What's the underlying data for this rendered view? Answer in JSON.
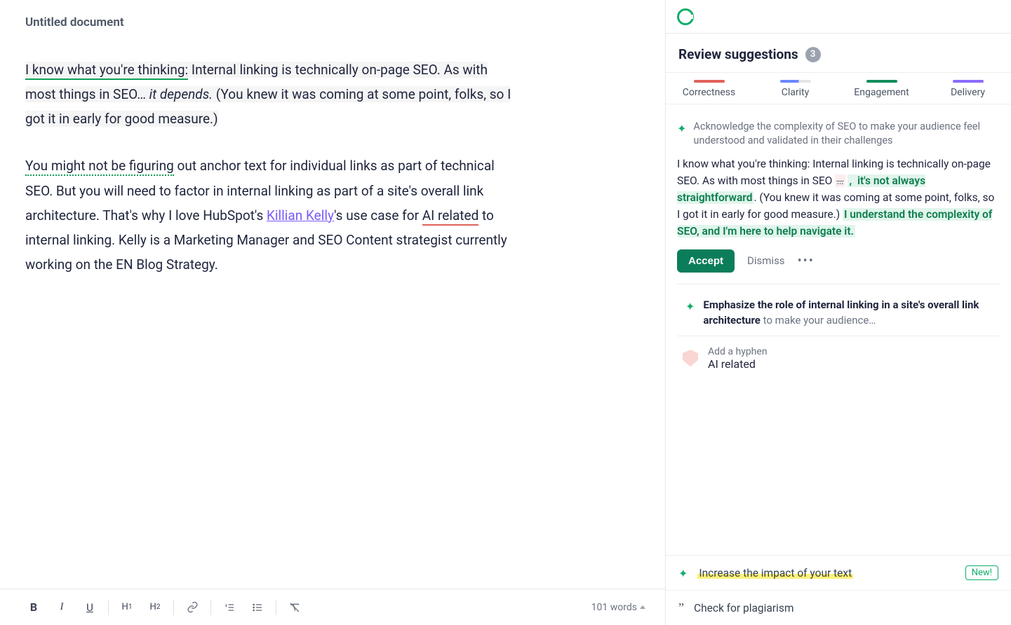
{
  "doc": {
    "title": "Untitled document",
    "p1a": "I know what you're thinking:",
    "p1b": " Internal linking is technically on-page SEO. As with most things in SEO… ",
    "p1c": "it depends.",
    "p1d": " (You knew it was coming at some point, folks, so I got it in early for good measure.)",
    "p2a": "You might not be figuring",
    "p2b": " out anchor text for individual links as part of technical SEO. But you will need to factor in internal linking as part of a site's overall link architecture. That's why I love HubSpot's ",
    "p2c": "Killian Kelly",
    "p2d": "'s use case for ",
    "p2e": "AI related",
    "p2f": " to internal linking. Kelly is a Marketing Manager and SEO Content strategist currently working on the EN Blog Strategy."
  },
  "toolbar": {
    "bold": "B",
    "italic": "I",
    "underline": "U",
    "h1": "H1",
    "h2": "H2",
    "word_count": "101 words"
  },
  "sidebar": {
    "title": "Review suggestions",
    "count": "3",
    "tabs": {
      "correctness": "Correctness",
      "clarity": "Clarity",
      "engagement": "Engagement",
      "delivery": "Delivery"
    },
    "card1": {
      "desc": "Acknowledge the complexity of SEO to make your audience feel understood and validated in their challenges",
      "t1": "I know what you're thinking: Internal linking is technically on-page SEO. As with most things in SEO ",
      "strike": "…",
      "ins1": ", ",
      "ins2": "it's not always straightforward",
      "t2": ". (You knew it was coming at some point, folks, so I got it in early for good measure.) ",
      "ins3": "I understand the complexity of SEO, and I'm here to help navigate it.",
      "accept": "Accept",
      "dismiss": "Dismiss"
    },
    "card2": {
      "bold": "Emphasize the role of internal linking in a site's overall link architecture",
      "gray": " to make your audience…"
    },
    "card3": {
      "label": "Add a hyphen",
      "text": "AI related"
    },
    "foot": {
      "impact": "Increase the impact of your text",
      "new": "New!",
      "plag": "Check for plagiarism"
    }
  }
}
